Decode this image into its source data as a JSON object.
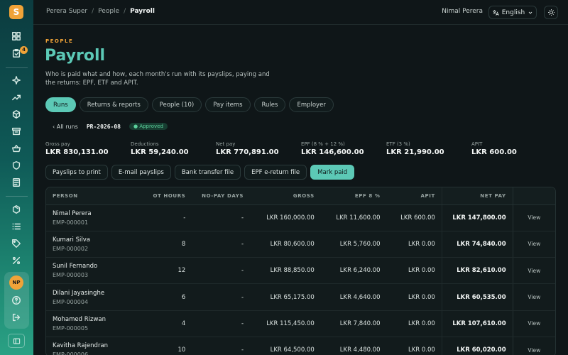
{
  "app": {
    "logo_letter": "S"
  },
  "sidebar": {
    "badge_count": "4",
    "avatar_initials": "NP",
    "icons": [
      "dashboard-icon",
      "tasks-icon",
      "sparkles-icon",
      "trending-icon",
      "cube-icon",
      "archive-icon",
      "basket-icon",
      "shield-icon",
      "ledger-icon",
      "package-icon",
      "list-icon",
      "tag-icon",
      "percent-icon",
      "help-icon",
      "logout-icon"
    ]
  },
  "topbar": {
    "breadcrumb": [
      "Perera Super",
      "People",
      "Payroll"
    ],
    "user_name": "Nimal Perera",
    "language": "English"
  },
  "header": {
    "eyebrow": "PEOPLE",
    "title": "Payroll",
    "description": "Who is paid what and how, each month's run with its payslips, paying and the returns: EPF, ETF and APIT."
  },
  "tabs": [
    {
      "label": "Runs",
      "active": true
    },
    {
      "label": "Returns & reports"
    },
    {
      "label": "People (10)"
    },
    {
      "label": "Pay items"
    },
    {
      "label": "Rules"
    },
    {
      "label": "Employer"
    }
  ],
  "run": {
    "back_label": "‹ All runs",
    "id": "PR-2026-08",
    "status": "Approved"
  },
  "stats": [
    {
      "label": "Gross pay",
      "value": "LKR 830,131.00"
    },
    {
      "label": "Deductions",
      "value": "LKR 59,240.00"
    },
    {
      "label": "Net pay",
      "value": "LKR 770,891.00"
    },
    {
      "label": "EPF (8 % + 12 %)",
      "value": "LKR 146,600.00"
    },
    {
      "label": "ETF (3 %)",
      "value": "LKR 21,990.00"
    },
    {
      "label": "APIT",
      "value": "LKR 600.00"
    }
  ],
  "actions": [
    "Payslips to print",
    "E-mail payslips",
    "Bank transfer file",
    "EPF e-return file",
    "Mark paid"
  ],
  "table": {
    "headers": [
      "PERSON",
      "OT HOURS",
      "NO-PAY DAYS",
      "GROSS",
      "EPF 8 %",
      "APIT",
      "NET PAY",
      ""
    ],
    "view_label": "View",
    "rows": [
      {
        "name": "Nimal Perera",
        "id": "EMP-000001",
        "ot": "-",
        "nopay": "-",
        "gross": "LKR 160,000.00",
        "epf": "LKR 11,600.00",
        "apit": "LKR 600.00",
        "net": "LKR 147,800.00"
      },
      {
        "name": "Kumari Silva",
        "id": "EMP-000002",
        "ot": "8",
        "nopay": "-",
        "gross": "LKR 80,600.00",
        "epf": "LKR 5,760.00",
        "apit": "LKR 0.00",
        "net": "LKR 74,840.00"
      },
      {
        "name": "Sunil Fernando",
        "id": "EMP-000003",
        "ot": "12",
        "nopay": "-",
        "gross": "LKR 88,850.00",
        "epf": "LKR 6,240.00",
        "apit": "LKR 0.00",
        "net": "LKR 82,610.00"
      },
      {
        "name": "Dilani Jayasinghe",
        "id": "EMP-000004",
        "ot": "6",
        "nopay": "-",
        "gross": "LKR 65,175.00",
        "epf": "LKR 4,640.00",
        "apit": "LKR 0.00",
        "net": "LKR 60,535.00"
      },
      {
        "name": "Mohamed Rizwan",
        "id": "EMP-000005",
        "ot": "4",
        "nopay": "-",
        "gross": "LKR 115,450.00",
        "epf": "LKR 7,840.00",
        "apit": "LKR 0.00",
        "net": "LKR 107,610.00"
      },
      {
        "name": "Kavitha Rajendran",
        "id": "EMP-000006",
        "ot": "10",
        "nopay": "-",
        "gross": "LKR 64,500.00",
        "epf": "LKR 4,480.00",
        "apit": "LKR 0.00",
        "net": "LKR 60,020.00"
      }
    ]
  }
}
